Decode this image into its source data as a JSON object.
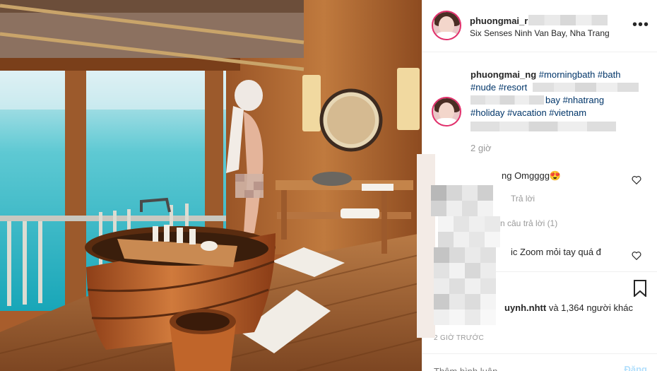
{
  "header": {
    "username": "phuongmai_r",
    "location": "Six Senses Ninh Van Bay, Nha Trang",
    "more_icon": "more-options-icon"
  },
  "caption": {
    "username": "phuongmai_ng",
    "line1_tags": "#morningbath #bath",
    "line2_tags": "#nude #resort",
    "line3_text": "bay #nhatrang",
    "line4_tags": "#holiday #vacation #vietnam",
    "time": "2 giờ"
  },
  "comments": [
    {
      "text": "ng Omgggg😍",
      "reply": "Trả lời"
    },
    {
      "view_replies": "n câu trả lời (1)"
    },
    {
      "text": "ic Zoom mỏi tay quá đ"
    }
  ],
  "likes": {
    "name": "uynh.nhtt",
    "rest": " và 1,364 người khác"
  },
  "date": "2 GIỜ TRƯỚC",
  "add_comment_placeholder": "Thêm bình luận...",
  "post_label": "Đăng",
  "colors": {
    "link": "#003569",
    "muted": "#999999",
    "post_button": "#b2dffc",
    "story_ring": "#e1306c"
  }
}
